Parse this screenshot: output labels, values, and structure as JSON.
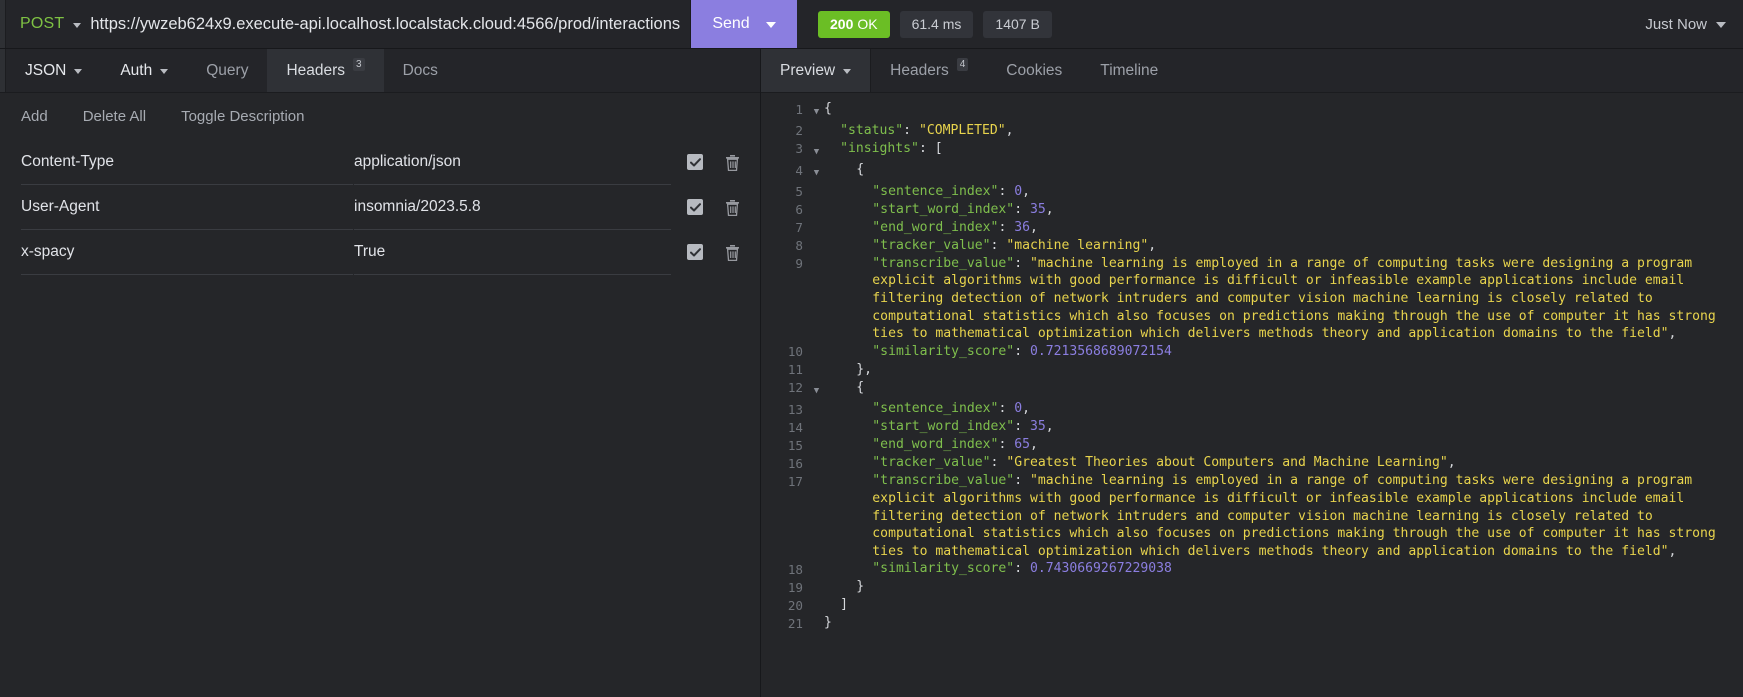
{
  "request_bar": {
    "method": "POST",
    "url": "https://ywzeb624x9.execute-api.localhost.localstack.cloud:4566/prod/interactions",
    "send_label": "Send",
    "status_code": "200",
    "status_text": "OK",
    "time": "61.4 ms",
    "size": "1407 B",
    "history_label": "Just Now"
  },
  "request_tabs": [
    {
      "label": "JSON",
      "has_caret": true,
      "badge": "",
      "active": false,
      "strong": true
    },
    {
      "label": "Auth",
      "has_caret": true,
      "badge": "",
      "active": false,
      "strong": true
    },
    {
      "label": "Query",
      "has_caret": false,
      "badge": "",
      "active": false,
      "strong": false
    },
    {
      "label": "Headers",
      "has_caret": false,
      "badge": "3",
      "active": true,
      "strong": false
    },
    {
      "label": "Docs",
      "has_caret": false,
      "badge": "",
      "active": false,
      "strong": false
    }
  ],
  "header_actions": [
    "Add",
    "Delete All",
    "Toggle Description"
  ],
  "headers_table": {
    "rows": [
      {
        "name": "Content-Type",
        "value": "application/json",
        "enabled": true
      },
      {
        "name": "User-Agent",
        "value": "insomnia/2023.5.8",
        "enabled": true
      },
      {
        "name": "x-spacy",
        "value": "True",
        "enabled": true
      }
    ]
  },
  "response_tabs": [
    {
      "label": "Preview",
      "has_caret": true,
      "badge": "",
      "active": true
    },
    {
      "label": "Headers",
      "has_caret": false,
      "badge": "4",
      "active": false
    },
    {
      "label": "Cookies",
      "has_caret": false,
      "badge": "",
      "active": false
    },
    {
      "label": "Timeline",
      "has_caret": false,
      "badge": "",
      "active": false
    }
  ],
  "response_json": {
    "status": "COMPLETED",
    "insights": [
      {
        "sentence_index": 0,
        "start_word_index": 35,
        "end_word_index": 36,
        "tracker_value": "machine learning",
        "transcribe_value": "machine learning is employed in a range of computing tasks were designing a program explicit algorithms with good performance is difficult or infeasible example applications include email filtering detection of network intruders and computer vision machine learning is closely related to computational statistics which also focuses on predictions making through the use of computer it has strong ties to mathematical optimization which delivers methods theory and application domains to the field",
        "similarity_score": "0.7213568689072154"
      },
      {
        "sentence_index": 0,
        "start_word_index": 35,
        "end_word_index": 65,
        "tracker_value": "Greatest Theories about Computers and Machine Learning",
        "transcribe_value": "machine learning is employed in a range of computing tasks were designing a program explicit algorithms with good performance is difficult or infeasible example applications include email filtering detection of network intruders and computer vision machine learning is closely related to computational statistics which also focuses on predictions making through the use of computer it has strong ties to mathematical optimization which delivers methods theory and application domains to the field",
        "similarity_score": "0.7430669267229038"
      }
    ]
  },
  "code_lines": [
    {
      "num": "1",
      "fold": true,
      "indent": 0,
      "tokens": [
        {
          "t": "p",
          "v": "{"
        }
      ]
    },
    {
      "num": "2",
      "fold": false,
      "indent": 1,
      "tokens": [
        {
          "t": "k",
          "v": "\"status\""
        },
        {
          "t": "p",
          "v": ": "
        },
        {
          "t": "s",
          "v": "\"COMPLETED\""
        },
        {
          "t": "p",
          "v": ","
        }
      ]
    },
    {
      "num": "3",
      "fold": true,
      "indent": 1,
      "tokens": [
        {
          "t": "k",
          "v": "\"insights\""
        },
        {
          "t": "p",
          "v": ": ["
        }
      ]
    },
    {
      "num": "4",
      "fold": true,
      "indent": 2,
      "tokens": [
        {
          "t": "p",
          "v": "{"
        }
      ]
    },
    {
      "num": "5",
      "fold": false,
      "indent": 3,
      "tokens": [
        {
          "t": "k",
          "v": "\"sentence_index\""
        },
        {
          "t": "p",
          "v": ": "
        },
        {
          "t": "n",
          "v": "0"
        },
        {
          "t": "p",
          "v": ","
        }
      ]
    },
    {
      "num": "6",
      "fold": false,
      "indent": 3,
      "tokens": [
        {
          "t": "k",
          "v": "\"start_word_index\""
        },
        {
          "t": "p",
          "v": ": "
        },
        {
          "t": "n",
          "v": "35"
        },
        {
          "t": "p",
          "v": ","
        }
      ]
    },
    {
      "num": "7",
      "fold": false,
      "indent": 3,
      "tokens": [
        {
          "t": "k",
          "v": "\"end_word_index\""
        },
        {
          "t": "p",
          "v": ": "
        },
        {
          "t": "n",
          "v": "36"
        },
        {
          "t": "p",
          "v": ","
        }
      ]
    },
    {
      "num": "8",
      "fold": false,
      "indent": 3,
      "tokens": [
        {
          "t": "k",
          "v": "\"tracker_value\""
        },
        {
          "t": "p",
          "v": ": "
        },
        {
          "t": "s",
          "v": "\"machine learning\""
        },
        {
          "t": "p",
          "v": ","
        }
      ]
    },
    {
      "num": "9",
      "fold": false,
      "indent": 3,
      "tokens": [
        {
          "t": "k",
          "v": "\"transcribe_value\""
        },
        {
          "t": "p",
          "v": ": "
        },
        {
          "t": "s",
          "v": "\"machine learning is employed in a range of computing tasks were designing a program explicit algorithms with good performance is difficult or infeasible example applications include email filtering detection of network intruders and computer vision machine learning is closely related to computational statistics which also focuses on predictions making through the use of computer it has strong ties to mathematical optimization which delivers methods theory and application domains to the field\""
        },
        {
          "t": "p",
          "v": ","
        }
      ]
    },
    {
      "num": "10",
      "fold": false,
      "indent": 3,
      "tokens": [
        {
          "t": "k",
          "v": "\"similarity_score\""
        },
        {
          "t": "p",
          "v": ": "
        },
        {
          "t": "n",
          "v": "0.7213568689072154"
        }
      ]
    },
    {
      "num": "11",
      "fold": false,
      "indent": 2,
      "tokens": [
        {
          "t": "p",
          "v": "},"
        }
      ]
    },
    {
      "num": "12",
      "fold": true,
      "indent": 2,
      "tokens": [
        {
          "t": "p",
          "v": "{"
        }
      ]
    },
    {
      "num": "13",
      "fold": false,
      "indent": 3,
      "tokens": [
        {
          "t": "k",
          "v": "\"sentence_index\""
        },
        {
          "t": "p",
          "v": ": "
        },
        {
          "t": "n",
          "v": "0"
        },
        {
          "t": "p",
          "v": ","
        }
      ]
    },
    {
      "num": "14",
      "fold": false,
      "indent": 3,
      "tokens": [
        {
          "t": "k",
          "v": "\"start_word_index\""
        },
        {
          "t": "p",
          "v": ": "
        },
        {
          "t": "n",
          "v": "35"
        },
        {
          "t": "p",
          "v": ","
        }
      ]
    },
    {
      "num": "15",
      "fold": false,
      "indent": 3,
      "tokens": [
        {
          "t": "k",
          "v": "\"end_word_index\""
        },
        {
          "t": "p",
          "v": ": "
        },
        {
          "t": "n",
          "v": "65"
        },
        {
          "t": "p",
          "v": ","
        }
      ]
    },
    {
      "num": "16",
      "fold": false,
      "indent": 3,
      "tokens": [
        {
          "t": "k",
          "v": "\"tracker_value\""
        },
        {
          "t": "p",
          "v": ": "
        },
        {
          "t": "s",
          "v": "\"Greatest Theories about Computers and Machine Learning\""
        },
        {
          "t": "p",
          "v": ","
        }
      ]
    },
    {
      "num": "17",
      "fold": false,
      "indent": 3,
      "tokens": [
        {
          "t": "k",
          "v": "\"transcribe_value\""
        },
        {
          "t": "p",
          "v": ": "
        },
        {
          "t": "s",
          "v": "\"machine learning is employed in a range of computing tasks were designing a program explicit algorithms with good performance is difficult or infeasible example applications include email filtering detection of network intruders and computer vision machine learning is closely related to computational statistics which also focuses on predictions making through the use of computer it has strong ties to mathematical optimization which delivers methods theory and application domains to the field\""
        },
        {
          "t": "p",
          "v": ","
        }
      ]
    },
    {
      "num": "18",
      "fold": false,
      "indent": 3,
      "tokens": [
        {
          "t": "k",
          "v": "\"similarity_score\""
        },
        {
          "t": "p",
          "v": ": "
        },
        {
          "t": "n",
          "v": "0.7430669267229038"
        }
      ]
    },
    {
      "num": "19",
      "fold": false,
      "indent": 2,
      "tokens": [
        {
          "t": "p",
          "v": "}"
        }
      ]
    },
    {
      "num": "20",
      "fold": false,
      "indent": 1,
      "tokens": [
        {
          "t": "p",
          "v": "]"
        }
      ]
    },
    {
      "num": "21",
      "fold": false,
      "indent": 0,
      "tokens": [
        {
          "t": "p",
          "v": "}"
        }
      ]
    }
  ],
  "colors": {
    "accent_send": "#8b7ee0",
    "status_ok": "#6bbe25",
    "method_post": "#7ec243",
    "json_key": "#7fbf4d",
    "json_string": "#e8d44d",
    "json_number": "#8b7ee0"
  }
}
